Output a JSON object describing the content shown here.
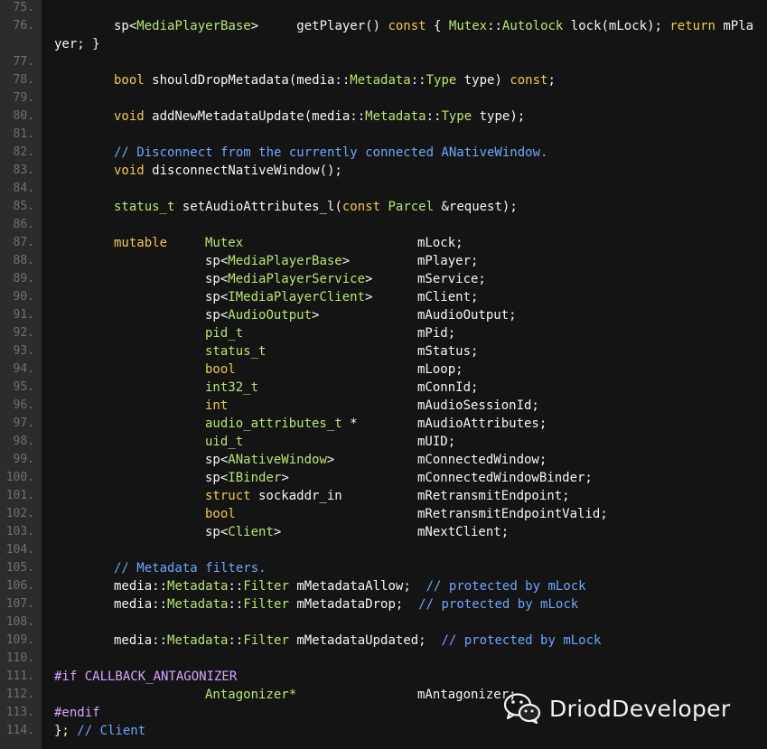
{
  "editor": {
    "line_numbers": [
      "75.",
      "76.",
      "",
      "77.",
      "78.",
      "79.",
      "80.",
      "81.",
      "82.",
      "83.",
      "84.",
      "85.",
      "86.",
      "87.",
      "88.",
      "89.",
      "90.",
      "91.",
      "92.",
      "93.",
      "94.",
      "95.",
      "96.",
      "97.",
      "98.",
      "99.",
      "100.",
      "101.",
      "102.",
      "103.",
      "104.",
      "105.",
      "106.",
      "107.",
      "108.",
      "109.",
      "110.",
      "111.",
      "112.",
      "113.",
      "114."
    ],
    "lines": {
      "l76a": [
        "sp<",
        "MediaPlayerBase",
        ">     getPlayer() ",
        "const",
        " { ",
        "Mutex",
        "::",
        "Autolock",
        " lock(mLock); ",
        "return",
        " mPla"
      ],
      "l76b": "yer; }",
      "l78": [
        "bool",
        " shouldDropMetadata(media::",
        "Metadata",
        "::",
        "Type",
        " type) ",
        "const",
        ";"
      ],
      "l80": [
        "void",
        " addNewMetadataUpdate(media::",
        "Metadata",
        "::",
        "Type",
        " type);"
      ],
      "l82": "// Disconnect from the currently connected ANativeWindow.",
      "l83": [
        "void",
        " disconnectNativeWindow();"
      ],
      "l85": [
        "status_t",
        " setAudioAttributes_l(",
        "const",
        " ",
        "Parcel",
        " &request);"
      ],
      "l87": {
        "kw": "mutable",
        "type": "Mutex",
        "name": "mLock;"
      },
      "members": [
        {
          "pre": "sp<",
          "type": "MediaPlayerBase",
          "post": ">",
          "name": "mPlayer;"
        },
        {
          "pre": "sp<",
          "type": "MediaPlayerService",
          "post": ">",
          "name": "mService;"
        },
        {
          "pre": "sp<",
          "type": "IMediaPlayerClient",
          "post": ">",
          "name": "mClient;"
        },
        {
          "pre": "sp<",
          "type": "AudioOutput",
          "post": ">",
          "name": "mAudioOutput;"
        },
        {
          "pre": "",
          "type": "pid_t",
          "post": "",
          "name": "mPid;"
        },
        {
          "pre": "",
          "type": "status_t",
          "post": "",
          "name": "mStatus;"
        },
        {
          "pre": "",
          "type": "bool",
          "post": "",
          "name": "mLoop;"
        },
        {
          "pre": "",
          "type": "int32_t",
          "post": "",
          "name": "mConnId;"
        },
        {
          "pre": "",
          "type": "int",
          "post": "",
          "name": "mAudioSessionId;"
        },
        {
          "pre": "",
          "type": "audio_attributes_t",
          "post": " *",
          "name": "mAudioAttributes;"
        },
        {
          "pre": "",
          "type": "uid_t",
          "post": "",
          "name": "mUID;"
        },
        {
          "pre": "sp<",
          "type": "ANativeWindow",
          "post": ">",
          "name": "mConnectedWindow;"
        },
        {
          "pre": "sp<",
          "type": "IBinder",
          "post": ">",
          "name": "mConnectedWindowBinder;"
        },
        {
          "pre": "",
          "type": "struct",
          "post": " sockaddr_in",
          "name": "mRetransmitEndpoint;"
        },
        {
          "pre": "",
          "type": "bool",
          "post": "",
          "name": "mRetransmitEndpointValid;"
        },
        {
          "pre": "sp<",
          "type": "Client",
          "post": ">",
          "name": "mNextClient;"
        }
      ],
      "l105": "// Metadata filters.",
      "l106": [
        "media::",
        "Metadata",
        "::",
        "Filter",
        " mMetadataAllow;  ",
        "// protected by mLock"
      ],
      "l107": [
        "media::",
        "Metadata",
        "::",
        "Filter",
        " mMetadataDrop;  ",
        "// protected by mLock"
      ],
      "l109": [
        "media::",
        "Metadata",
        "::",
        "Filter",
        " mMetadataUpdated;  ",
        "// protected by mLock"
      ],
      "l111": "#if CALLBACK_ANTAGONIZER",
      "l112": {
        "type": "Antagonizer*",
        "name": "mAntagonizer;"
      },
      "l113": "#endif",
      "l114": [
        "};",
        " // Client"
      ]
    }
  },
  "watermark": {
    "text": "DriodDeveloper",
    "icon": "wechat-icon"
  },
  "colors": {
    "background": "#141414",
    "gutter": "#2c2c2c",
    "keyword": "#f2c94c",
    "type": "#b7e66f",
    "comment": "#6aa7ff",
    "preprocessor": "#d9a3ff",
    "text": "#f5f5f5",
    "line_number": "#6f6f6f"
  }
}
